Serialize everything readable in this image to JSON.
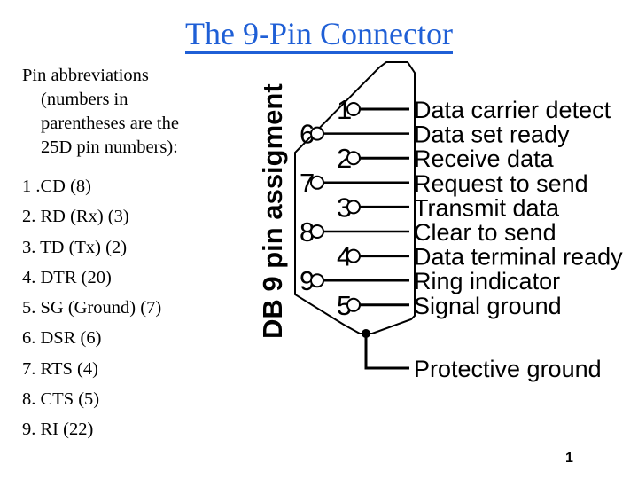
{
  "title": "The 9-Pin Connector",
  "intro": {
    "line1": "Pin abbreviations",
    "line2": "(numbers in",
    "line3": "parentheses are the",
    "line4": "25D pin numbers):"
  },
  "pin_list": [
    "1 .CD (8)",
    "2. RD (Rx) (3)",
    "3. TD (Tx) (2)",
    "4. DTR (20)",
    "5. SG (Ground) (7)",
    "6. DSR (6)",
    "7. RTS (4)",
    "8. CTS (5)",
    "9. RI (22)"
  ],
  "diagram": {
    "vertical_label": "DB 9 pin assigment",
    "pins": [
      {
        "number": "1",
        "signal": "Data carrier detect"
      },
      {
        "number": "6",
        "signal": "Data set ready"
      },
      {
        "number": "2",
        "signal": "Receive data"
      },
      {
        "number": "7",
        "signal": "Request to send"
      },
      {
        "number": "3",
        "signal": "Transmit data"
      },
      {
        "number": "8",
        "signal": "Clear to send"
      },
      {
        "number": "4",
        "signal": "Data terminal ready"
      },
      {
        "number": "9",
        "signal": "Ring indicator"
      },
      {
        "number": "5",
        "signal": "Signal ground"
      }
    ],
    "ground_label": "Protective ground"
  },
  "page_number": "1"
}
